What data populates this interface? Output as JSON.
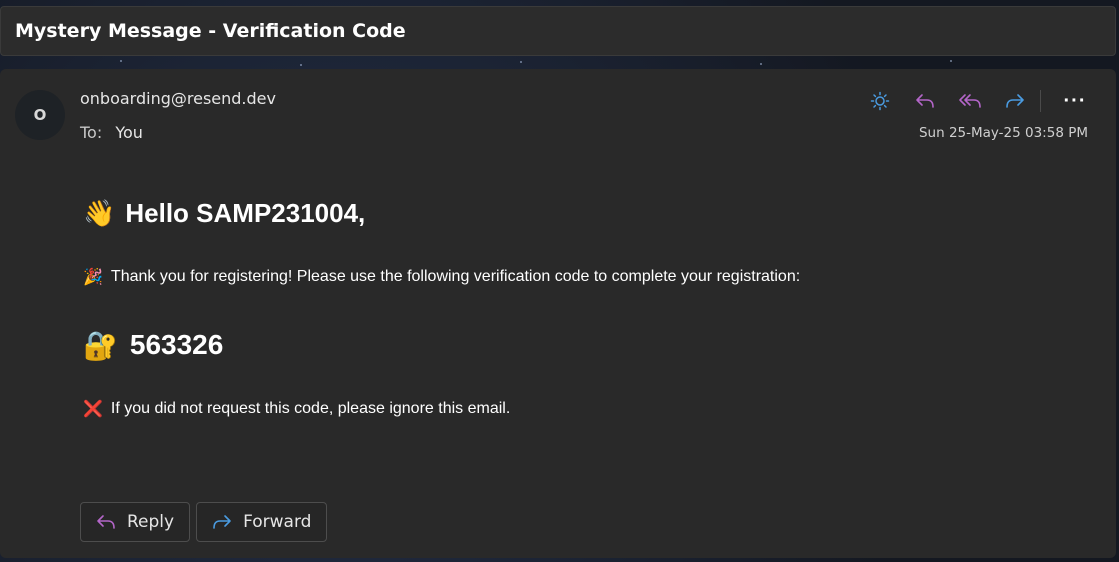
{
  "window": {
    "subject": "Mystery Message - Verification Code"
  },
  "header": {
    "avatar_initial": "O",
    "sender": "onboarding@resend.dev",
    "to_label": "To:",
    "to_name": "You",
    "date": "Sun 25-May-25 03:58 PM",
    "actions": {
      "icons": [
        "brightness-icon",
        "reply-icon",
        "reply-all-icon",
        "forward-icon",
        "more-icon"
      ],
      "more_label": "···"
    }
  },
  "body": {
    "greeting_emoji": "👋",
    "greeting": "Hello SAMP231004,",
    "thanks_emoji": "🎉",
    "thanks": "Thank you for registering! Please use the following verification code to complete your registration:",
    "code_emoji": "🔐",
    "code": "563326",
    "note_emoji": "❌",
    "note": "If you did not request this code, please ignore this email."
  },
  "footer": {
    "reply_label": "Reply",
    "forward_label": "Forward"
  },
  "colors": {
    "reply_accent": "#b466c9",
    "forward_accent": "#4a9be0",
    "panel": "#292929"
  }
}
